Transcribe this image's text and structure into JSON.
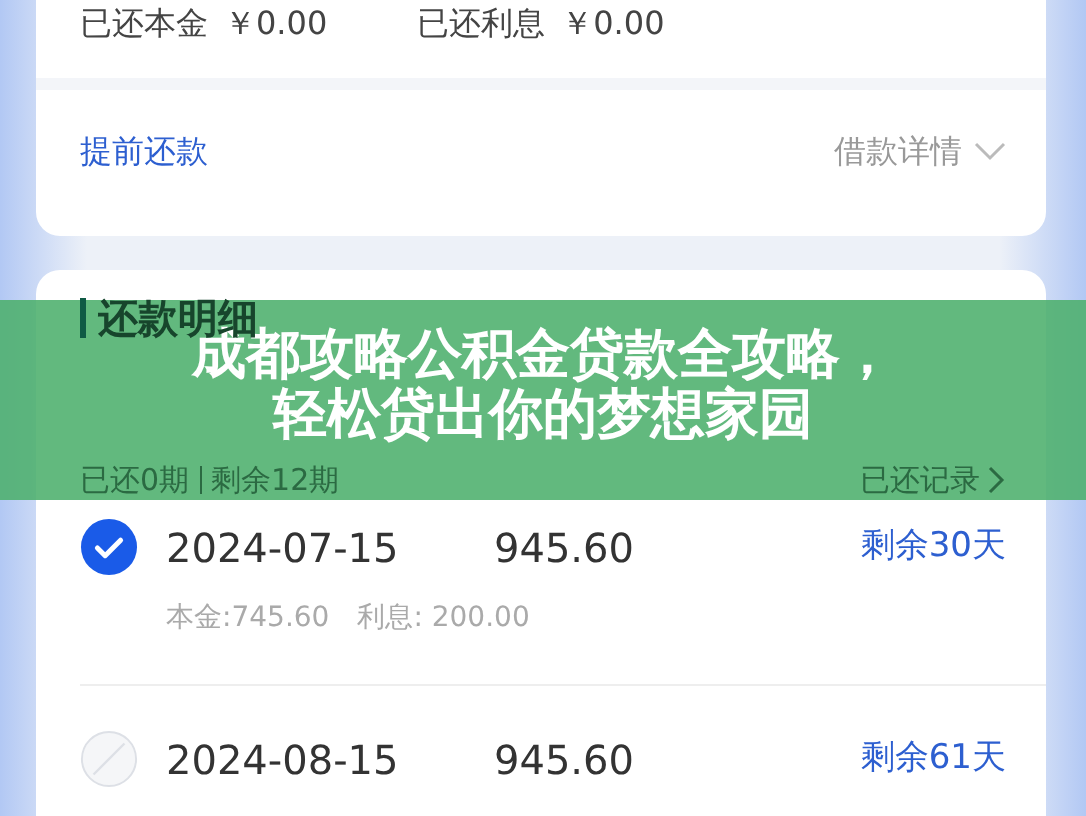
{
  "repaid_summary": [
    {
      "label": "已还本金",
      "value": "￥0.00"
    },
    {
      "label": "已还利息",
      "value": "￥0.00"
    }
  ],
  "actions": {
    "prepay": "提前还款",
    "details": "借款详情"
  },
  "schedule": {
    "title": "还款明细",
    "paid_periods": "已还0期",
    "remaining_periods": "剩余12期",
    "history_link": "已还记录"
  },
  "installments": [
    {
      "date": "2024-07-15",
      "amount": "945.60",
      "remaining": "剩余30天",
      "selected": true,
      "disabled": false,
      "principal": "本金:745.60",
      "interest": "利息: 200.00"
    },
    {
      "date": "2024-08-15",
      "amount": "945.60",
      "remaining": "剩余61天",
      "selected": false,
      "disabled": true
    }
  ],
  "banner": {
    "lines": [
      "成都攻略公积金贷款全攻略，",
      "轻松贷出你的梦想家园"
    ]
  }
}
